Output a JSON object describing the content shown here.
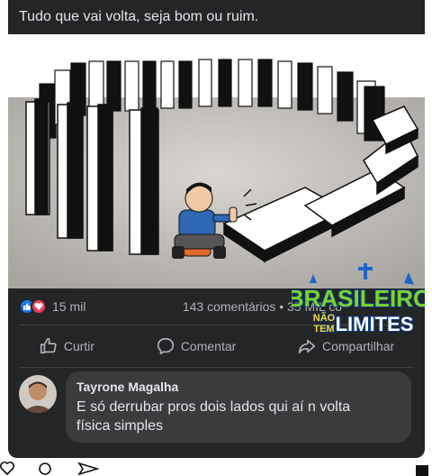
{
  "post": {
    "caption": "Tudo que vai volta, seja bom ou ruim."
  },
  "brand": {
    "line1": "BRASILEIRO",
    "line2_left": "NÃO",
    "line2_left_b": "TEM",
    "line2_right": "LIMITES"
  },
  "stats": {
    "reaction_count": "15 mil",
    "comments_shares": "143 comentários • 35 MIL co"
  },
  "actions": {
    "like_label": "Curtir",
    "comment_label": "Comentar",
    "share_label": "Compartilhar"
  },
  "comment": {
    "author": "Tayrone Magalha",
    "text_line1": "E só derrubar pros dois lados qui aí n volta",
    "text_line2": "física simples"
  },
  "colors": {
    "card_bg": "#242526",
    "text_primary": "#e4e6eb",
    "text_secondary": "#b0b3b8",
    "like_blue": "#1877f2",
    "love_red": "#f33e58"
  },
  "icons": [
    "like-icon",
    "love-icon",
    "thumbs-up-icon",
    "comment-icon",
    "share-icon",
    "heart-icon",
    "search-icon",
    "send-icon"
  ]
}
